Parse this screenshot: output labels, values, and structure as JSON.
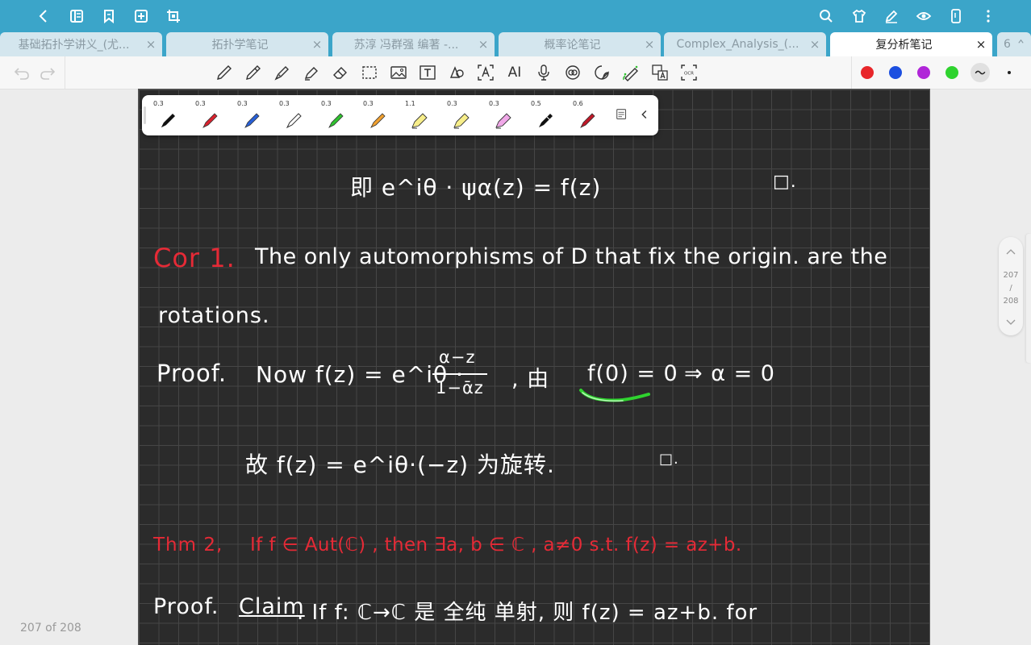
{
  "topbar": {
    "left_icons": [
      "back-icon",
      "reader-mode-icon",
      "bookmark-icon",
      "add-page-icon",
      "crop-icon"
    ],
    "right_icons": [
      "search-icon",
      "shirt-theme-icon",
      "pen-edit-icon",
      "eye-icon",
      "phone-icon",
      "more-icon"
    ]
  },
  "tabs": [
    {
      "label": "基础拓扑学讲义_(尤...",
      "active": false
    },
    {
      "label": "拓扑学笔记",
      "active": false
    },
    {
      "label": "苏淳 冯群强 编著 -...",
      "active": false
    },
    {
      "label": "概率论笔记",
      "active": false
    },
    {
      "label": "Complex_Analysis_(...",
      "active": false
    },
    {
      "label": "复分析笔记",
      "active": true
    }
  ],
  "tab_close": "×",
  "tab_counter": "6",
  "toolbar": {
    "tools": [
      "pen-icon",
      "pencil-icon",
      "fountain-pen-icon",
      "highlighter-icon",
      "eraser-icon",
      "lasso-icon",
      "image-icon",
      "text-box-icon",
      "shape-icon",
      "text-recognition-icon",
      "ai-icon",
      "microphone-icon",
      "sticker-icon",
      "sticky-note-icon",
      "laser-pointer-icon",
      "translate-icon",
      "ocr-icon"
    ],
    "ai_label": "AI",
    "ocr_label": "OCR",
    "colors": [
      "#e8262a",
      "#1c4fe0",
      "#b026d8",
      "#2fd32f"
    ]
  },
  "pens": [
    {
      "size": "0.3",
      "color": "#111111"
    },
    {
      "size": "0.3",
      "color": "#d9222e"
    },
    {
      "size": "0.3",
      "color": "#2860d8"
    },
    {
      "size": "0.3",
      "color": "#ffffff"
    },
    {
      "size": "0.3",
      "color": "#2fc22f"
    },
    {
      "size": "0.3",
      "color": "#f0a030"
    },
    {
      "size": "1.1",
      "color": "#f7ee8a"
    },
    {
      "size": "0.3",
      "color": "#f7ee8a"
    },
    {
      "size": "0.3",
      "color": "#f0a8e8"
    },
    {
      "size": "0.5",
      "color": "#111111"
    },
    {
      "size": "0.6",
      "color": "#c01828"
    }
  ],
  "notes": {
    "line1": "即  e^iθ · ψα(z) = f(z)",
    "line1_qed": "□.",
    "cor_label": "Cor 1.",
    "cor_text": "The  only  automorphisms  of  D  that  fix  the  origin.  are  the",
    "cor_text2": "rotations.",
    "proof_label": "Proof.",
    "proof1": "Now  f(z) = e^iθ ·",
    "frac_num": "α−z",
    "frac_den": "1−ᾱz",
    "proof1b": ",  由",
    "proof1c": "f(0) = 0",
    "proof1d": "⇒  α = 0",
    "line_gu": "故  f(z) = e^iθ·(−z)  为旋转.",
    "line_gu_qed": "□.",
    "thm_label": "Thm 2,",
    "thm_text": "If  f ∈ Aut(ℂ) ,  then  ∃a, b ∈ ℂ ,  a≠0  s.t.  f(z) = az+b.",
    "proof2_label": "Proof.",
    "claim": "Claim",
    "proof2_text": ".   If  f: ℂ→ℂ  是 全纯 单射,  则  f(z) = az+b.   for"
  },
  "pagenav": {
    "current": "207",
    "separator": "/",
    "total": "208"
  },
  "page_counter": "207 of 208"
}
